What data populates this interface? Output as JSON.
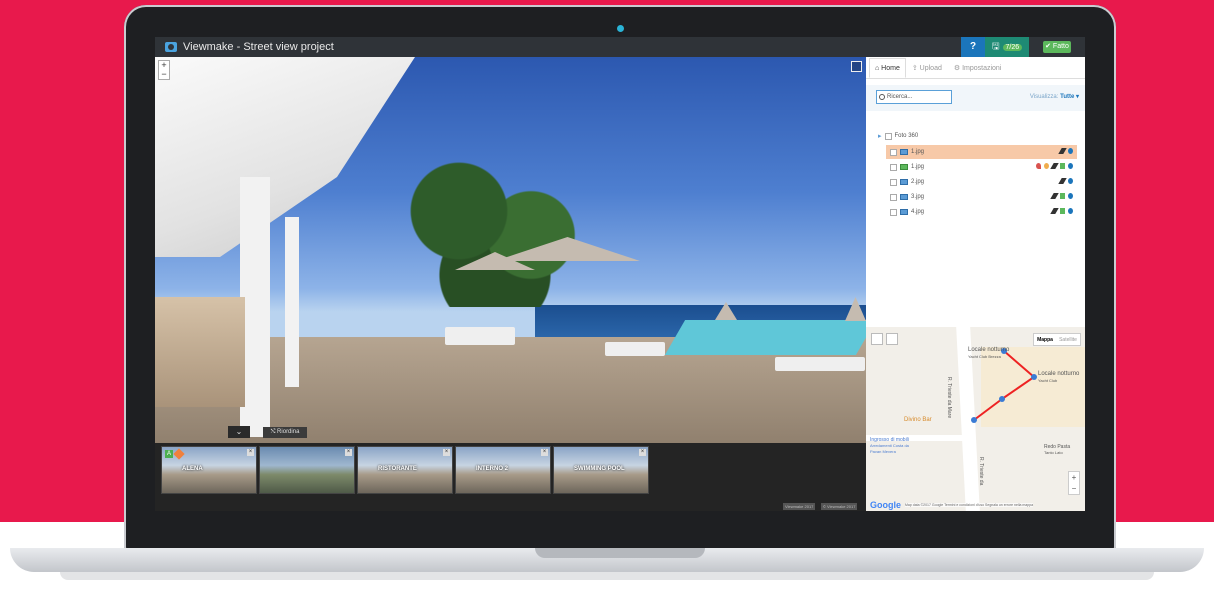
{
  "window": {
    "title": "Viewmake - Street view project"
  },
  "topbar": {
    "help_label": "?",
    "save_badge": "7/26",
    "done_label": "✔ Fatto"
  },
  "viewer": {
    "zoom_in": "+",
    "zoom_out": "−",
    "reorder_label": "⤭ Riordina",
    "collapse_label": "⌄",
    "copyright": [
      "Viewmake 2017",
      "© Viewmake 2017"
    ]
  },
  "filmstrip": [
    {
      "label": "ALENA",
      "badge": "A"
    },
    {
      "label": ""
    },
    {
      "label": "RISTORANTE"
    },
    {
      "label": "INTERNO 2"
    },
    {
      "label": "SWIMMING POOL"
    }
  ],
  "panel": {
    "tabs": [
      {
        "label": "⌂ Home",
        "active": true
      },
      {
        "label": "⇪ Upload",
        "active": false
      },
      {
        "label": "⚙ Impostazioni",
        "active": false
      }
    ],
    "search_placeholder": "Ricerca...",
    "view_label": "Visualizza:",
    "view_value": "Tutte ▾",
    "tree_root": "Foto 360",
    "files": [
      {
        "name": "1.jpg",
        "selected": true,
        "green": false
      },
      {
        "name": "1.jpg",
        "selected": false,
        "green": true
      },
      {
        "name": "2.jpg",
        "selected": false,
        "green": false
      },
      {
        "name": "3.jpg",
        "selected": false,
        "green": false
      },
      {
        "name": "4.jpg",
        "selected": false,
        "green": false
      }
    ]
  },
  "map": {
    "type_map": "Mappa",
    "type_sat": "Satellite",
    "labels": {
      "place1": "Locale notturno",
      "place1_sub": "Yacht Club Brezza",
      "place2": "Locale notturno",
      "place2_sub": "Yacht Club",
      "bar": "Divino Bar",
      "shop": "Ingrosso di mobili",
      "shop_sub2": "Arredamenti Costa da",
      "shop_sub3": "Pavan Mevera",
      "street1": "R. Trieste da Mare",
      "street2": "R. Trieste da",
      "redo": "Redo Pasta",
      "redo_sub": "Tanto Lato"
    },
    "zoom_in": "+",
    "zoom_out": "−",
    "google": "Google",
    "terms": "Map data ©2017 Google   Termini e condizioni d'uso   Segnala un errore nella mappa"
  },
  "colors": {
    "background": "#e8194c",
    "topbar": "#2f3338",
    "selected_row": "#f7c9a8",
    "accent": "#1b75bb"
  }
}
